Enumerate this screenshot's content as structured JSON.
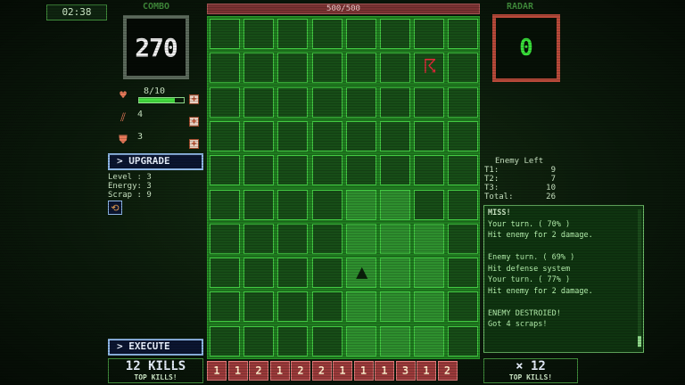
{
  "timer": "02:38",
  "combo": {
    "label": "COMBO",
    "value": "270"
  },
  "stats": {
    "health": {
      "icon": "heart-icon",
      "value": "8/10",
      "fill": 0.8
    },
    "attack": {
      "icon": "claw-icon",
      "value": "4"
    },
    "defense": {
      "icon": "shield-icon",
      "value": "3"
    }
  },
  "buttons": {
    "upgrade": "> UPGRADE",
    "execute": "> EXECUTE"
  },
  "info": {
    "level": "Level : 3",
    "energy": "Energy: 3",
    "scrap": "Scrap : 9"
  },
  "board": {
    "header": "500/500"
  },
  "radar": {
    "label": "RADAR",
    "value": "0"
  },
  "enemy_left": {
    "title": "Enemy Left",
    "rows": [
      {
        "k": "T1:",
        "v": "9"
      },
      {
        "k": "T2:",
        "v": "7"
      },
      {
        "k": "T3:",
        "v": "10"
      },
      {
        "k": "Total:",
        "v": "26"
      }
    ]
  },
  "log": {
    "lines": [
      "MISS!",
      "Your turn. ( 70% )",
      "Hit enemy for 2 damage.",
      "",
      "Enemy turn. ( 69% )",
      "Hit defense system",
      "Your turn. ( 77% )",
      "Hit enemy for 2 damage.",
      "",
      "ENEMY DESTROIED!",
      "Got 4 scraps!"
    ]
  },
  "kills": {
    "left": "12 KILLS",
    "left_sub": "TOP KILLS!",
    "right": "× 12",
    "right_sub": "TOP KILLS!"
  },
  "cards": [
    "1",
    "1",
    "2",
    "1",
    "2",
    "2",
    "1",
    "1",
    "1",
    "3",
    "1",
    "2"
  ],
  "colors": {
    "accent": "#43c943",
    "card": "#9a3a3a",
    "radar_border": "#b84a3a"
  }
}
